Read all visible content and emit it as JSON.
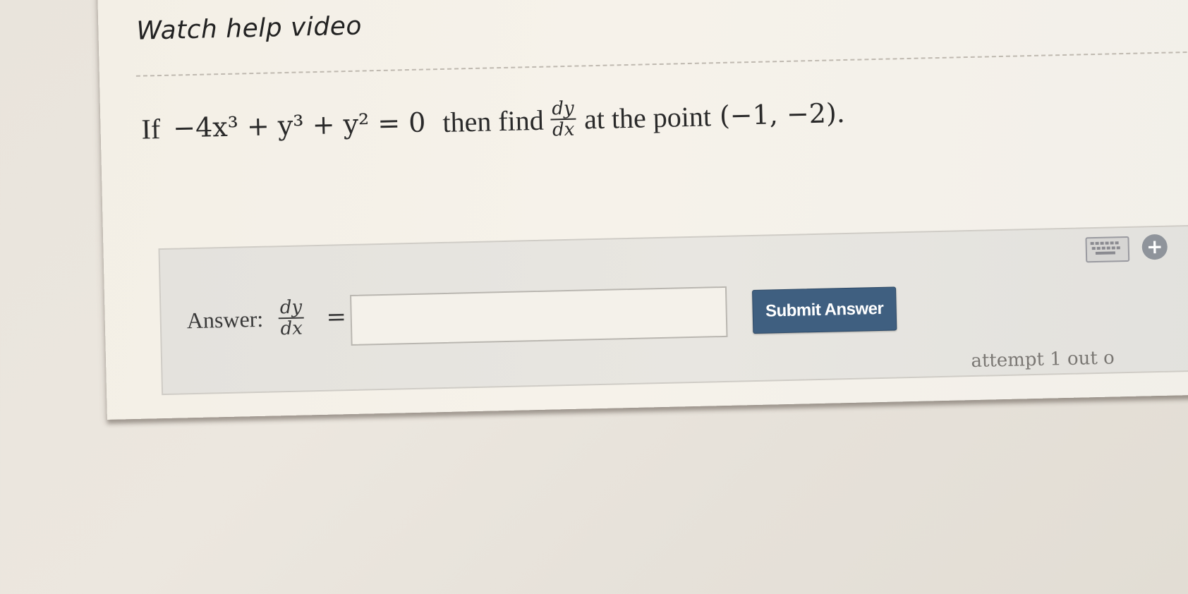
{
  "help_link": "Watch help video",
  "question": {
    "prefix": "If",
    "equation": "−4x³ + y³ + y² = 0",
    "middle": "then find",
    "frac_num": "dy",
    "frac_den": "dx",
    "suffix": "at the point",
    "point": "(−1, −2)."
  },
  "answer": {
    "label": "Answer:",
    "frac_num": "dy",
    "frac_den": "dx",
    "equals": "=",
    "input_value": "",
    "submit_label": "Submit Answer"
  },
  "toolbar": {
    "keyboard_icon": "keyboard-icon",
    "plus_icon": "plus-circle-icon",
    "plus_glyph": "+"
  },
  "attempt_text": "attempt 1 out o"
}
